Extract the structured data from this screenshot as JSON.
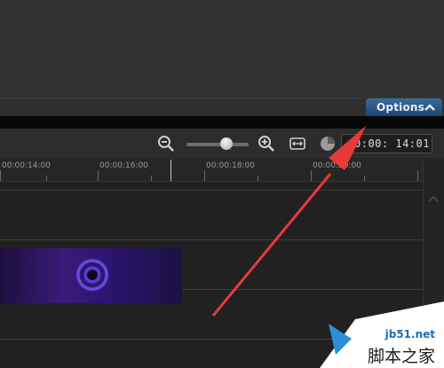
{
  "options_panel": {
    "label": "Options",
    "chevron": "▲"
  },
  "toolbar": {
    "timecode": "0:00: 14:01",
    "icons": [
      "zoom-out-icon",
      "zoom-in-icon",
      "fit-to-timeline-icon",
      "clock-icon"
    ],
    "zoom_level_fraction": 0.62
  },
  "ruler": {
    "labels": [
      "00:00:14:00",
      "00:00:16:00",
      "00:00:18:00",
      "00:00:20:00"
    ]
  },
  "colors": {
    "accent": "#2a5a8a",
    "annotation_arrow": "#e83a3a",
    "clip": "#3a1a78"
  },
  "watermark": {
    "site": "jb51.net",
    "chinese": "脚本之家"
  }
}
